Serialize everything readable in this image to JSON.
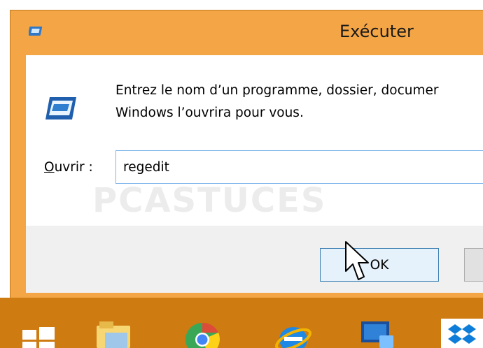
{
  "window": {
    "title": "Exécuter"
  },
  "dialog": {
    "message_line1": "Entrez le nom d’un programme, dossier, documer",
    "message_line2": "Windows l’ouvrira pour vous.",
    "open_label_accel": "O",
    "open_label_rest": "uvrir :",
    "input_value": "regedit",
    "ok_label": "OK",
    "watermark": "PCASTUCES"
  },
  "taskbar": {
    "items": [
      "windows-start",
      "file-explorer",
      "chrome",
      "internet-explorer",
      "remote-desktop",
      "dropbox"
    ]
  },
  "colors": {
    "title_frame": "#f4a646",
    "taskbar": "#ce7b12",
    "input_border": "#7eb4ea",
    "ok_border": "#3c7fb1"
  }
}
